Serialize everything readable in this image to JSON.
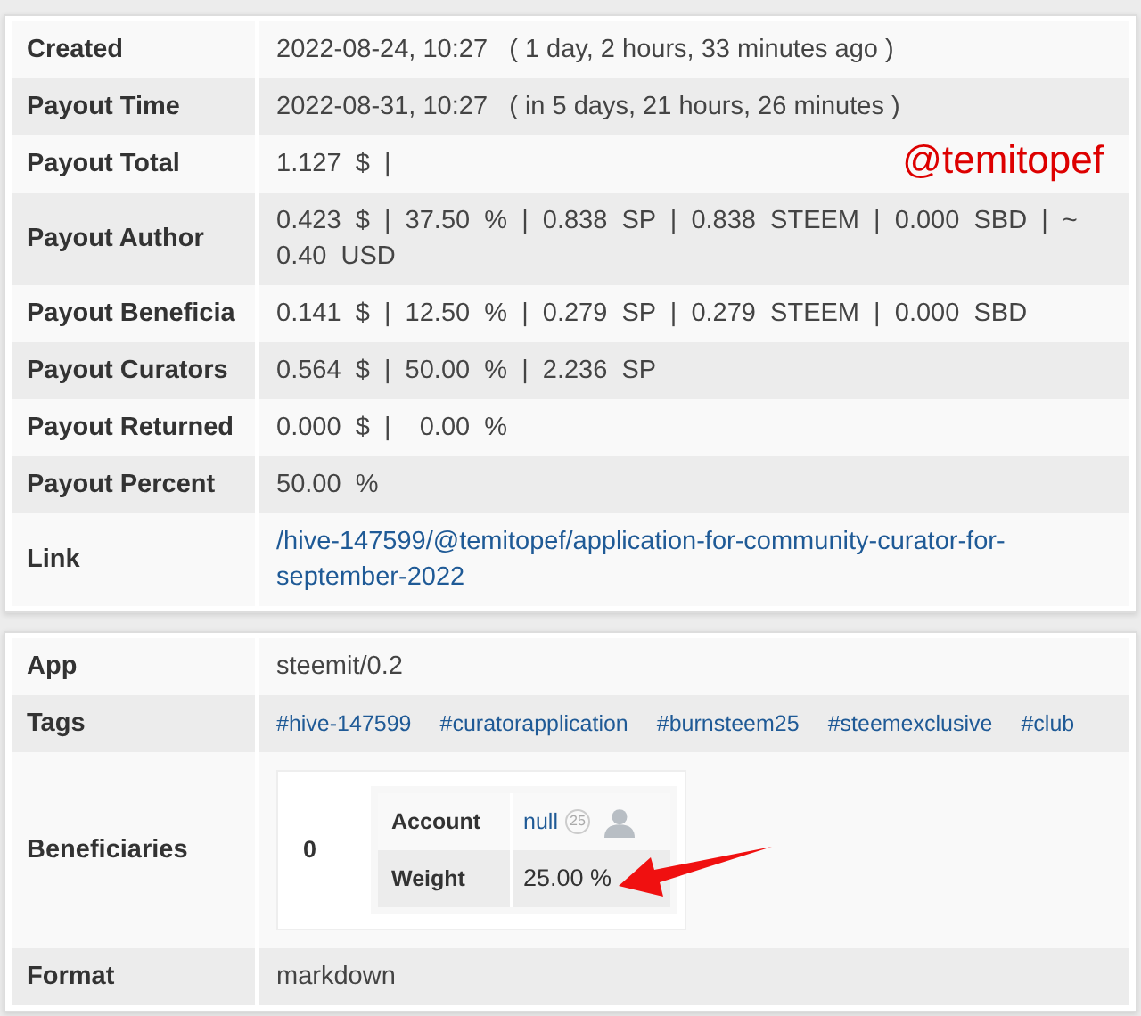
{
  "annotation": {
    "text": "@temitopef"
  },
  "post_details": {
    "rows": [
      {
        "kind": "text",
        "label": "Created",
        "value": "2022-08-24, 10:27   ( 1 day, 2 hours, 33 minutes ago )"
      },
      {
        "kind": "text",
        "label": "Payout Time",
        "value": "2022-08-31, 10:27   ( in 5 days, 21 hours, 26 minutes )"
      },
      {
        "kind": "text",
        "label": "Payout Total",
        "value": "1.127  $  |"
      },
      {
        "kind": "text",
        "label": "Payout Author",
        "value": "0.423  $  |  37.50  %  |  0.838  SP  |  0.838  STEEM  |  0.000  SBD  |  ~ 0.40  USD"
      },
      {
        "kind": "text",
        "label": "Payout Beneficia",
        "value": "0.141  $  |  12.50  %  |  0.279  SP  |  0.279  STEEM  |  0.000  SBD"
      },
      {
        "kind": "text",
        "label": "Payout Curators",
        "value": "0.564  $  |  50.00  %  |  2.236  SP"
      },
      {
        "kind": "text",
        "label": "Payout Returned",
        "value": "0.000  $  |    0.00  %"
      },
      {
        "kind": "text",
        "label": "Payout Percent",
        "value": "50.00  %"
      },
      {
        "kind": "link",
        "label": "Link",
        "value": "/hive-147599/@temitopef/application-for-community-curator-for-september-2022"
      }
    ]
  },
  "metadata": {
    "rows": [
      {
        "kind": "text",
        "label": "App",
        "value": "steemit/0.2"
      },
      {
        "kind": "tags",
        "label": "Tags",
        "tags": [
          "#hive-147599",
          "#curatorapplication",
          "#burnsteem25",
          "#steemexclusive",
          "#club"
        ]
      },
      {
        "kind": "beneficiaries",
        "label": "Beneficiaries",
        "index": "0",
        "account_label": "Account",
        "account": "null",
        "reputation": "25",
        "weight_label": "Weight",
        "weight": "25.00 %"
      },
      {
        "kind": "text",
        "label": "Format",
        "value": "markdown"
      }
    ]
  }
}
